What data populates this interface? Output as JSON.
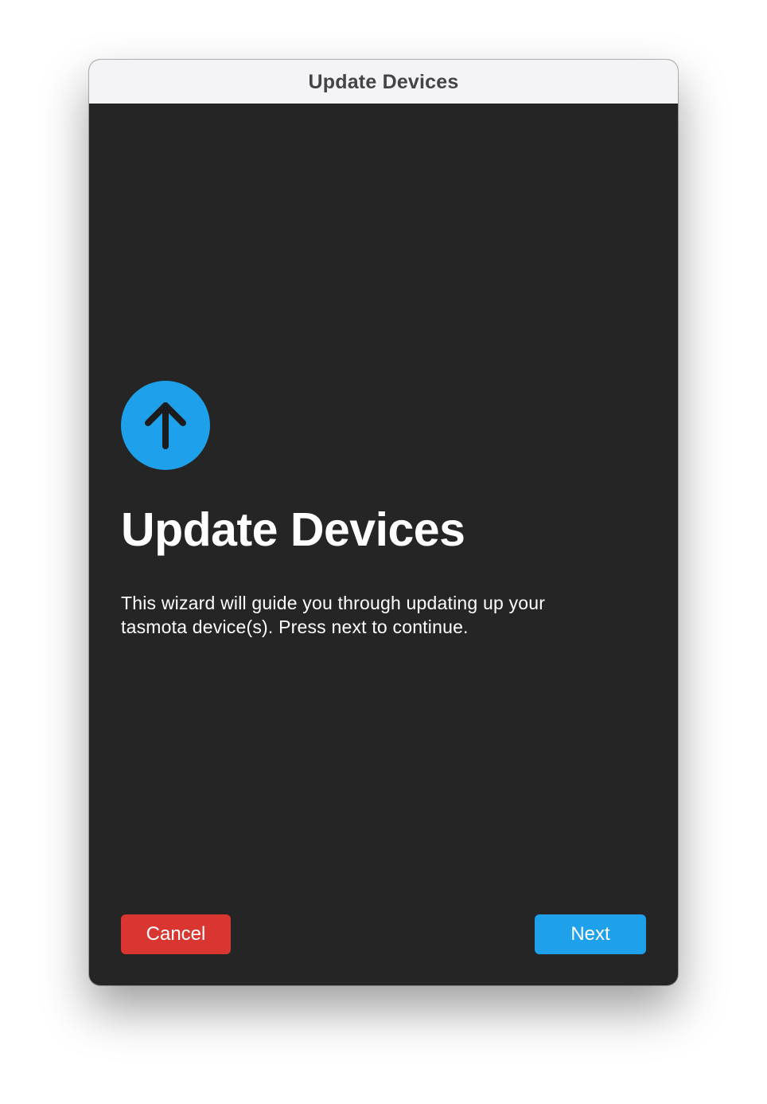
{
  "window": {
    "title": "Update Devices"
  },
  "main": {
    "icon": "arrow-up-circle-icon",
    "heading": "Update Devices",
    "description": "This wizard will guide you through updating up your tasmota device(s). Press next to continue."
  },
  "footer": {
    "cancel_label": "Cancel",
    "next_label": "Next"
  },
  "colors": {
    "accent": "#1ea1ea",
    "danger": "#d93632",
    "background": "#252525",
    "titlebar": "#f4f4f6"
  }
}
